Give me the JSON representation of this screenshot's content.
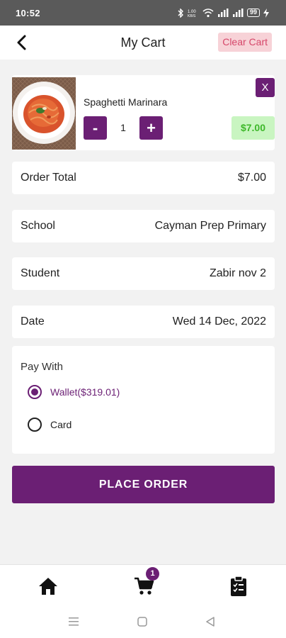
{
  "status_bar": {
    "time": "10:52",
    "network_label": "1.00\nKB/S",
    "battery": "99"
  },
  "header": {
    "title": "My Cart",
    "clear_cart_label": "Clear Cart"
  },
  "cart_item": {
    "name": "Spaghetti Marinara",
    "quantity": "1",
    "minus_label": "-",
    "plus_label": "+",
    "remove_label": "X",
    "price": "$7.00"
  },
  "order_total": {
    "label": "Order Total",
    "value": "$7.00"
  },
  "school": {
    "label": "School",
    "value": "Cayman Prep Primary"
  },
  "student": {
    "label": "Student",
    "value": "Zabir nov 2"
  },
  "date": {
    "label": "Date",
    "value": "Wed 14 Dec, 2022"
  },
  "pay_with": {
    "title": "Pay With",
    "options": [
      {
        "label": "Wallet($319.01)",
        "selected": true
      },
      {
        "label": "Card",
        "selected": false
      }
    ]
  },
  "place_order_label": "PLACE ORDER",
  "bottom_nav": {
    "cart_badge_count": "1",
    "items": [
      "home-icon",
      "cart-icon",
      "clipboard-check-icon"
    ]
  },
  "colors": {
    "primary": "#6b1f74",
    "price_bg": "#c9f5c1",
    "price_text": "#3eb82a",
    "clear_cart_bg": "#f7d2d7",
    "clear_cart_text": "#d6476a"
  }
}
